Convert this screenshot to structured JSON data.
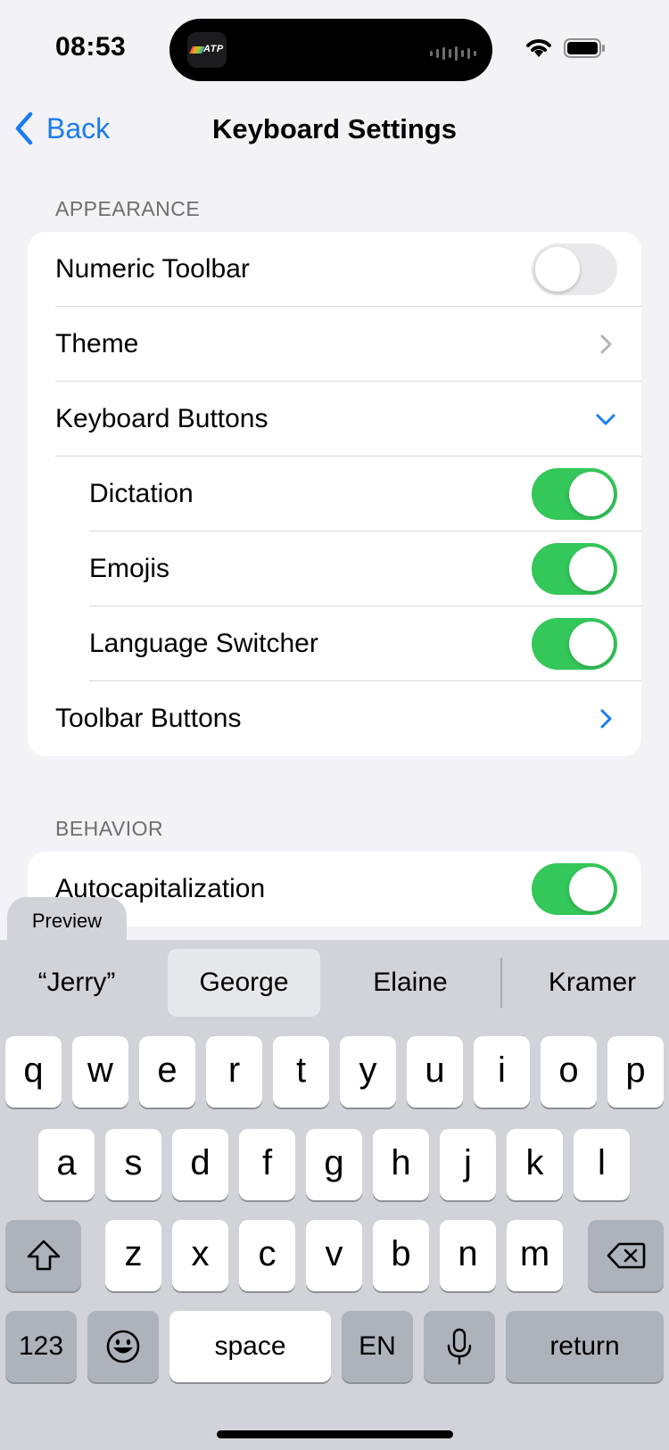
{
  "status": {
    "time": "08:53",
    "island_app": "ATP"
  },
  "nav": {
    "back_label": "Back",
    "title": "Keyboard Settings"
  },
  "appearance": {
    "header": "APPEARANCE",
    "rows": [
      {
        "label": "Numeric Toolbar",
        "control": "toggle",
        "on": false
      },
      {
        "label": "Theme",
        "control": "chevron-right"
      },
      {
        "label": "Keyboard Buttons",
        "control": "chevron-down",
        "expanded": true
      },
      {
        "label": "Dictation",
        "control": "toggle",
        "on": true,
        "indent": true
      },
      {
        "label": "Emojis",
        "control": "toggle",
        "on": true,
        "indent": true
      },
      {
        "label": "Language Switcher",
        "control": "toggle",
        "on": true,
        "indent": true
      },
      {
        "label": "Toolbar Buttons",
        "control": "chevron-right"
      }
    ]
  },
  "behavior": {
    "header": "BEHAVIOR",
    "rows": [
      {
        "label": "Autocapitalization",
        "control": "toggle",
        "on": true
      }
    ]
  },
  "keyboard": {
    "preview_label": "Preview",
    "suggestions": [
      "“Jerry”",
      "George",
      "Elaine",
      "Kramer"
    ],
    "row1": [
      "q",
      "w",
      "e",
      "r",
      "t",
      "y",
      "u",
      "i",
      "o",
      "p"
    ],
    "row2": [
      "a",
      "s",
      "d",
      "f",
      "g",
      "h",
      "j",
      "k",
      "l"
    ],
    "row3": [
      "z",
      "x",
      "c",
      "v",
      "b",
      "n",
      "m"
    ],
    "numbers_label": "123",
    "space_label": "space",
    "language_label": "EN",
    "return_label": "return"
  },
  "colors": {
    "accent": "#1a7cf0",
    "toggle_on": "#34c759",
    "background": "#f2f2f7"
  }
}
